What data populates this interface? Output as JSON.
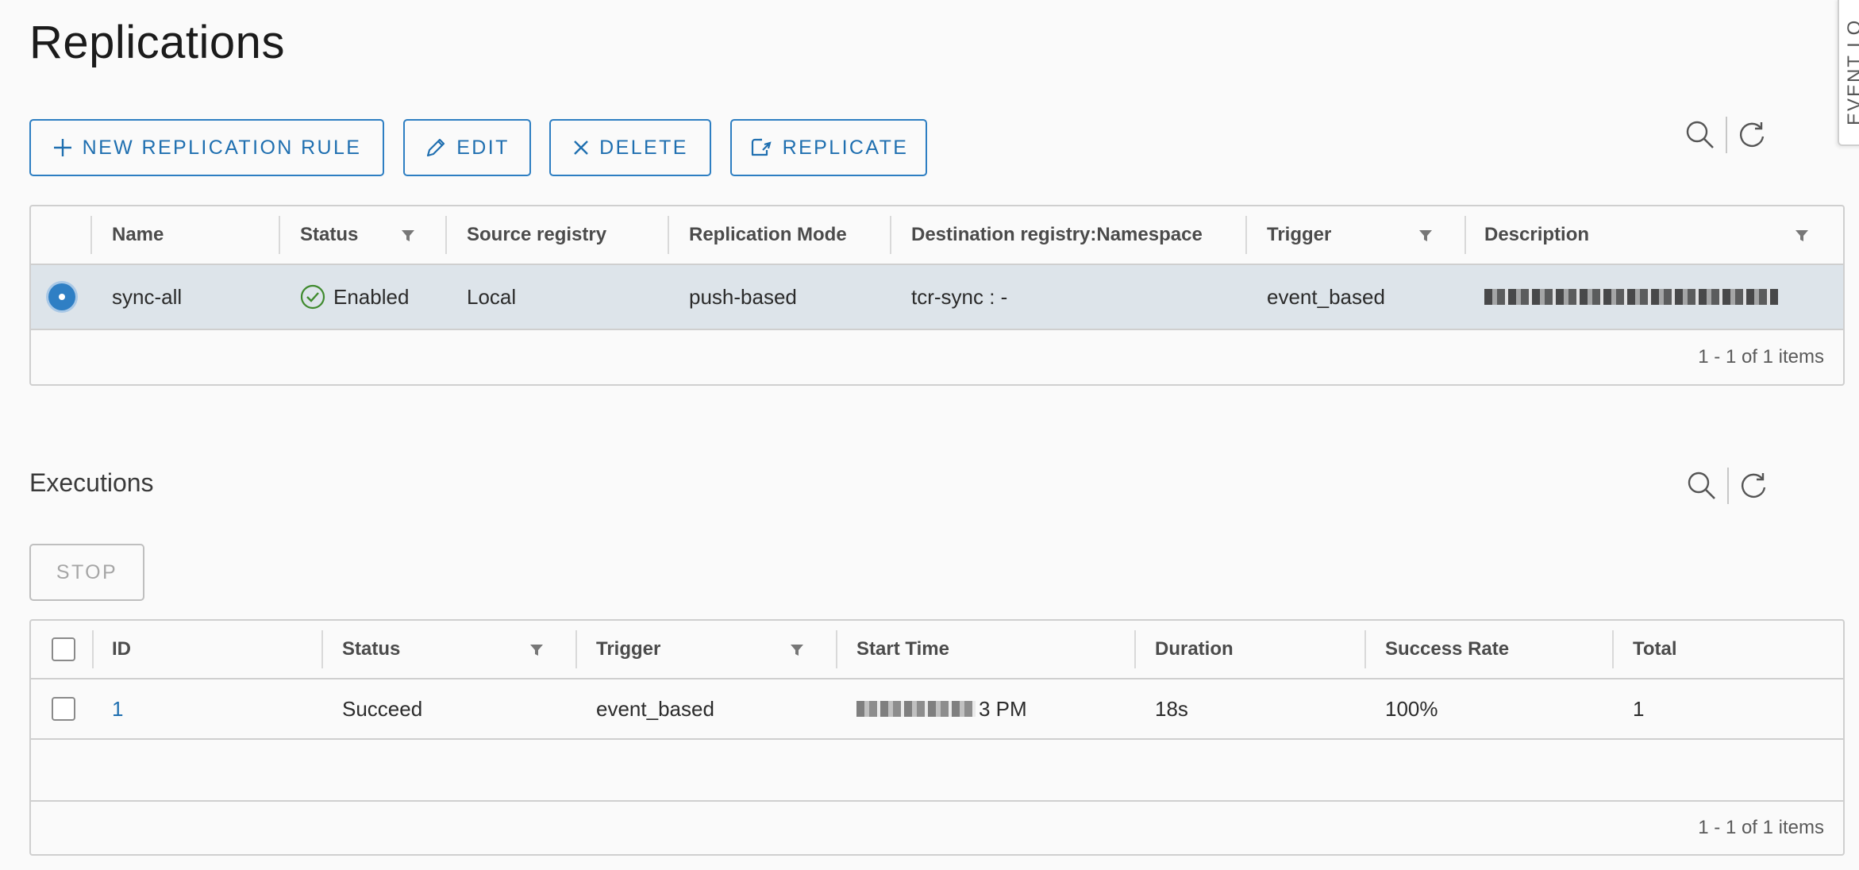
{
  "title": "Replications",
  "side_tab_label": "EVENT LO",
  "toolbar": {
    "new_rule": "NEW REPLICATION RULE",
    "edit": "EDIT",
    "delete": "DELETE",
    "replicate": "REPLICATE"
  },
  "replications": {
    "columns": [
      "Name",
      "Status",
      "Source registry",
      "Replication Mode",
      "Destination registry:Namespace",
      "Trigger",
      "Description"
    ],
    "rows": [
      {
        "name": "sync-all",
        "status": "Enabled",
        "source": "Local",
        "mode": "push-based",
        "destination": "tcr-sync : -",
        "trigger": "event_based",
        "description": ""
      }
    ],
    "footer": "1 - 1 of 1 items"
  },
  "executions": {
    "title": "Executions",
    "stop": "STOP",
    "columns": [
      "ID",
      "Status",
      "Trigger",
      "Start Time",
      "Duration",
      "Success Rate",
      "Total"
    ],
    "rows": [
      {
        "id": "1",
        "status": "Succeed",
        "trigger": "event_based",
        "start_time_suffix": "3 PM",
        "duration": "18s",
        "success_rate": "100%",
        "total": "1"
      }
    ],
    "footer": "1 - 1 of 1 items"
  },
  "colors": {
    "accent": "#1f6fb0",
    "selected_row": "#dde4ea",
    "success": "#3f8a2e",
    "link": "#1f6fb0"
  },
  "icons": [
    "plus-icon",
    "pencil-icon",
    "close-icon",
    "replicate-icon",
    "search-icon",
    "refresh-icon",
    "filter-icon",
    "check-circle-icon"
  ]
}
